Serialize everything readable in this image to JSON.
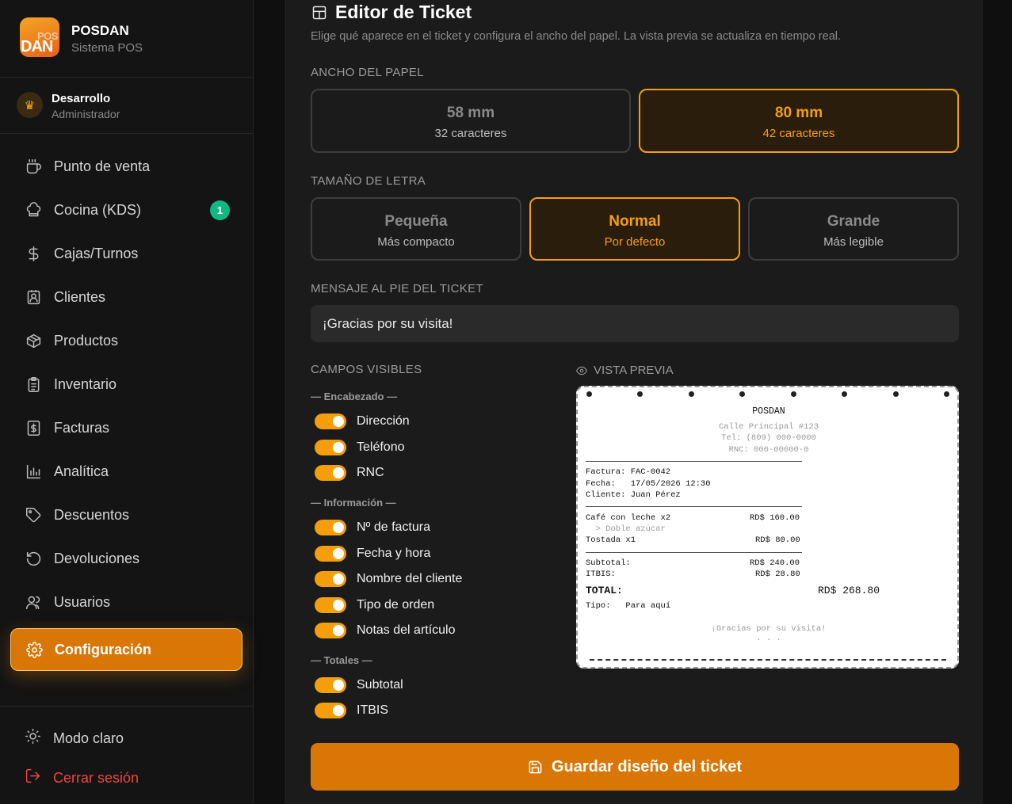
{
  "brand": {
    "logo_top": "POS",
    "logo_bottom": "DAN",
    "name": "POSDAN",
    "subtitle": "Sistema POS"
  },
  "user": {
    "name": "Desarrollo",
    "role": "Administrador",
    "avatar_icon": "crown-icon"
  },
  "nav": {
    "items": [
      {
        "label": "Punto de venta",
        "icon": "coffee-cup-icon"
      },
      {
        "label": "Cocina (KDS)",
        "icon": "chef-hat-icon",
        "badge": "1"
      },
      {
        "label": "Cajas/Turnos",
        "icon": "dollar-icon"
      },
      {
        "label": "Clientes",
        "icon": "contact-icon"
      },
      {
        "label": "Productos",
        "icon": "package-icon"
      },
      {
        "label": "Inventario",
        "icon": "clipboard-icon"
      },
      {
        "label": "Facturas",
        "icon": "receipt-dollar-icon"
      },
      {
        "label": "Analítica",
        "icon": "bar-chart-icon"
      },
      {
        "label": "Descuentos",
        "icon": "tag-icon"
      },
      {
        "label": "Devoluciones",
        "icon": "undo-icon"
      },
      {
        "label": "Usuarios",
        "icon": "users-icon"
      },
      {
        "label": "Configuración",
        "icon": "gear-icon",
        "active": true
      }
    ],
    "theme_label": "Modo claro",
    "logout_label": "Cerrar sesión"
  },
  "colors": {
    "accent": "#d97706",
    "accent_light": "#f59e0b",
    "badge": "#10b981",
    "logout": "#ef4444"
  },
  "editor": {
    "title": "Editor de Ticket",
    "subtitle": "Elige qué aparece en el ticket y configura el ancho del papel. La vista previa se actualiza en tiempo real.",
    "paper_label": "ANCHO DEL PAPEL",
    "paper_options": [
      {
        "main": "58 mm",
        "sub": "32 caracteres",
        "selected": false
      },
      {
        "main": "80 mm",
        "sub": "42 caracteres",
        "selected": true
      }
    ],
    "font_label": "TAMAÑO DE LETRA",
    "font_options": [
      {
        "main": "Pequeña",
        "sub": "Más compacto",
        "selected": false
      },
      {
        "main": "Normal",
        "sub": "Por defecto",
        "selected": true
      },
      {
        "main": "Grande",
        "sub": "Más legible",
        "selected": false
      }
    ],
    "footer_label": "MENSAJE AL PIE DEL TICKET",
    "footer_value": "¡Gracias por su visita!",
    "fields_label": "CAMPOS VISIBLES",
    "groups": {
      "header": {
        "title": "— Encabezado —",
        "items": [
          "Dirección",
          "Teléfono",
          "RNC"
        ]
      },
      "info": {
        "title": "— Información —",
        "items": [
          "Nº de factura",
          "Fecha y hora",
          "Nombre del cliente",
          "Tipo de orden",
          "Notas del artículo"
        ]
      },
      "totals": {
        "title": "— Totales —",
        "items": [
          "Subtotal",
          "ITBIS"
        ]
      }
    },
    "preview_label": "VISTA PREVIA",
    "save_label": "Guardar diseño del ticket"
  },
  "receipt": {
    "name": "POSDAN",
    "address": "Calle Principal #123",
    "phone": "Tel: (809) 000-0000",
    "rnc": "RNC: 000-00000-0",
    "invoice": "Factura: FAC-0042",
    "date": "Fecha:   17/05/2026 12:30",
    "client": "Cliente: Juan Pérez",
    "item1": "Café con leche x2",
    "item1_price": "RD$ 160.00",
    "item1_note": "  > Doble azúcar",
    "item2": "Tostada x1",
    "item2_price": "RD$ 80.00",
    "subtotal_label": "Subtotal:",
    "subtotal": "RD$ 240.00",
    "itbis_label": "ITBIS:",
    "itbis": "RD$ 28.80",
    "total_label": "TOTAL:",
    "total": "RD$ 268.80",
    "type": "Tipo:   Para aquí",
    "thanks": "¡Gracias por su visita!",
    "dots": ". . ."
  }
}
